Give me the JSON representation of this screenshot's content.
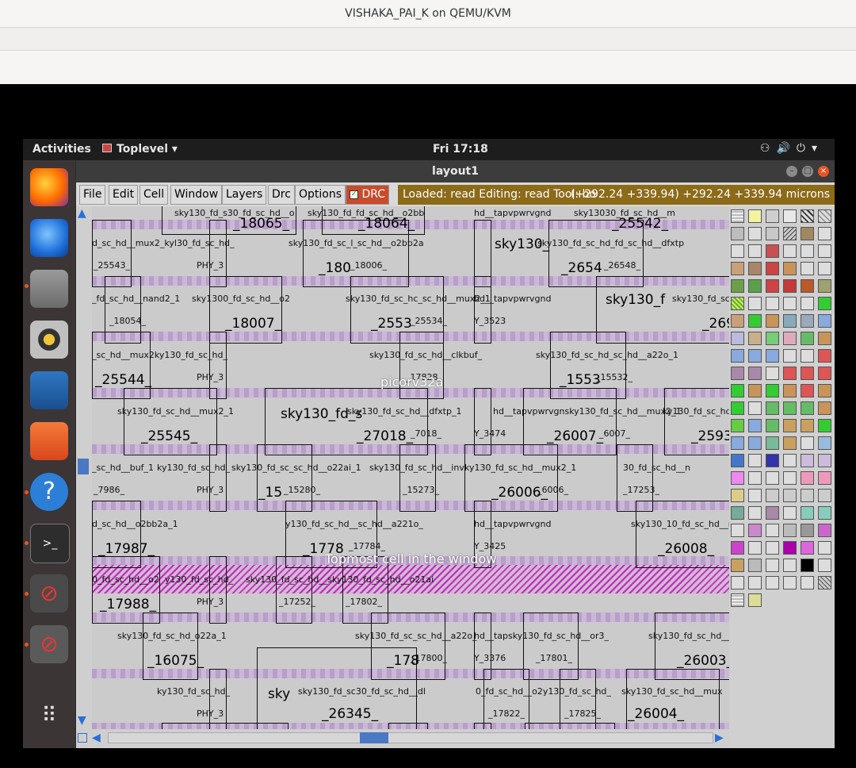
{
  "host": {
    "title": "VISHAKA_PAI_K on QEMU/KVM"
  },
  "topbar": {
    "activities": "Activities",
    "app_menu": "Toplevel",
    "clock": "Fri 17:18"
  },
  "window": {
    "title": "layout1"
  },
  "menu": {
    "file": "File",
    "edit": "Edit",
    "cell": "Cell",
    "window": "Window",
    "layers": "Layers",
    "drc": "Drc",
    "options": "Options",
    "drc_toggle": "DRC"
  },
  "status": {
    "text": "Loaded: read Editing: read Tool: bo",
    "coords": "(+292.24 +339.94) +292.24 +339.94 microns"
  },
  "overlays": {
    "cell_name": "picorv32a",
    "topmost": "Topmost cell in the window"
  },
  "layout": {
    "small_labels": [
      "sky130_fd_s30_fd_sc_hd__o",
      "sky130_fd_fd_sc_hd__o2bb",
      "hd__tapvpwrvgnd",
      "sky13030_fd_sc_hd__m",
      "d_sc_hd__mux2_kyl30_fd_sc_hd_",
      "sky130_fd_sc_l_sc_hd__o2bb2a",
      "sky130_fd_sc_hd_fd_sc_hd__dfxtp",
      "_25543_",
      "PHY_3",
      "_18006_",
      "_26548_",
      "_fd_sc_hd__nand2_1",
      "sky1300_fd_sc_hd__o2",
      "sky130_fd_sc_hc_sc_hd__mux2_1",
      "hd__tapvpwrvgnd",
      "sky130_fd_sc_h",
      "_18054_",
      "_25534_",
      "Y_3523",
      "_sc_hd__mux2ky130_fd_sc_hd_",
      "sky130_fd_sc_hd__clkbuf_",
      "sky130_fd_sc_hd_sc_hd__a22o_1",
      "PHY_3",
      "_17828_",
      "_15532_",
      "sky130_fd_sc_hd__mux2_1",
      "sky130_fd_sc_hd__dfxtp_1",
      "hd__tapvpwrvgnsky130_fd_sc_hd__mux2_1",
      "ky130_fd_sc_hd_",
      "_7018_",
      "Y_3474",
      "_6007_",
      "_sc_hd__buf_1",
      "ky130_fd_sc_hd_",
      "sky130_fd_sc_sc_hd__o22ai_1",
      "sky130_fd_sc_hd__inv",
      "ky130_fd_sc_hd__mux2_1",
      "30_fd_sc_hd__n",
      "_7986_",
      "PHY_3",
      "_15280_",
      "_15273_",
      "_6006_",
      "_17253_",
      "d_sc_hd__o2bb2a_1",
      "y130_fd_sc_hd__sc_hd__a221o_",
      "hd__tapvpwrvgnd",
      "sky130_10_fd_sc_hd__mu",
      "_17784_",
      "Y_3425",
      "0_fd_sc_hd__o2",
      "y130_fd_sc_hd_",
      "sky130_fd_sc_hd__sky130_fd_sc_hd__o21ai",
      "_17252_",
      "_17802_",
      "PHY_3",
      "sky130_fd_sc_hd_o22a_1",
      "sky130_fd_sc_sc_hd__a22o_",
      "hd__tapsky130_fd_sc_hd__or3_",
      "sky130_fd_sc_hd__s",
      "_17800_",
      "Y_3376",
      "_17801_",
      "ky130_fd_sc_hd_",
      "sky130_fd_sc30_fd_sc_hd__dl",
      "0_fd_sc_hd__o2y130_fd_sc_hd_",
      "sky130_fd_sc_hd__mux",
      "PHY_3",
      "_17822_",
      "_17825_"
    ],
    "big_labels": [
      "_18065_",
      "_18064_",
      "_25542_",
      "_180",
      "_2654",
      "sky130_",
      "_18007_",
      "_2553",
      "sky130_f",
      "_269",
      "_25544_",
      "_1553",
      "_25545_",
      "_27018_",
      "_26007_",
      "_2593",
      "sky130_fd_s",
      "_15",
      "_26006_",
      "_17987_",
      "_1778",
      "_26008_",
      "_17988_",
      "_16075_",
      "_178",
      "_26003_",
      "_26345_",
      "_26004_",
      "sky"
    ]
  }
}
